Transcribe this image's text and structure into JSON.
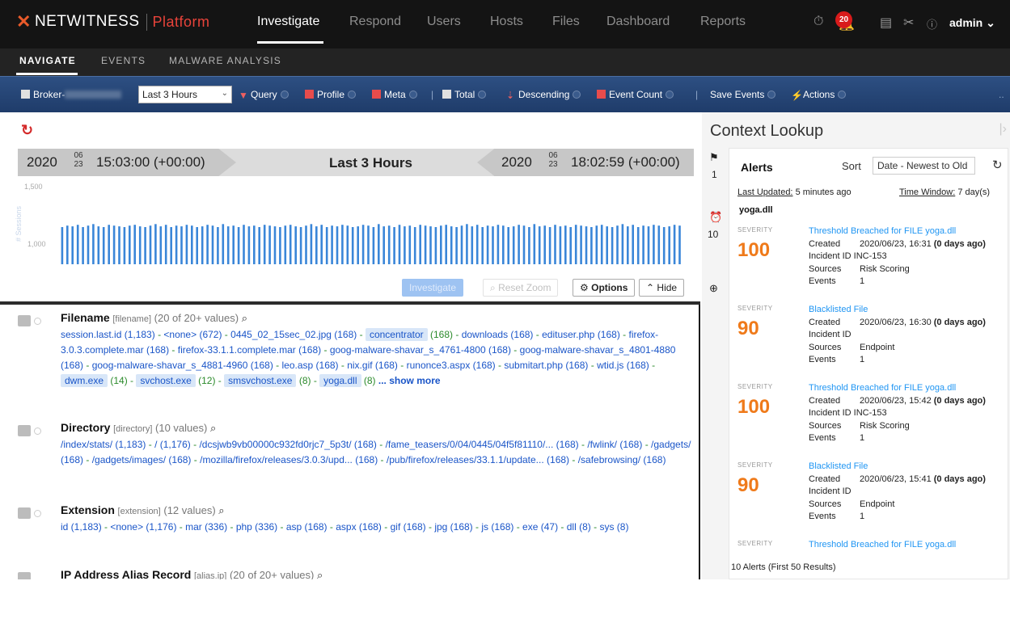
{
  "brand": {
    "name": "NETWITNESS",
    "product": "Platform"
  },
  "nav": {
    "items": [
      {
        "label": "Investigate",
        "active": true
      },
      {
        "label": "Respond",
        "active": false
      },
      {
        "label": "Users",
        "active": false
      },
      {
        "label": "Hosts",
        "active": false
      },
      {
        "label": "Files",
        "active": false
      },
      {
        "label": "Dashboard",
        "active": false
      },
      {
        "label": "Reports",
        "active": false
      }
    ],
    "notification_count": "20",
    "user": "admin"
  },
  "subnav": {
    "items": [
      "NAVIGATE",
      "EVENTS",
      "MALWARE ANALYSIS"
    ]
  },
  "toolbar": {
    "broker": "Broker-",
    "time_range": "Last 3 Hours",
    "query": "Query",
    "profile": "Profile",
    "meta": "Meta",
    "total": "Total",
    "descending": "Descending",
    "event_count": "Event Count",
    "save_events": "Save Events",
    "actions": "Actions"
  },
  "timeline": {
    "start_year": "2020",
    "start_month": "06",
    "start_day": "23",
    "start_time": "15:03:00 (+00:00)",
    "range_label": "Last 3 Hours",
    "end_year": "2020",
    "end_month": "06",
    "end_day": "23",
    "end_time": "18:02:59 (+00:00)",
    "y_ticks": [
      "1,500",
      "1,000"
    ],
    "y_axis_label": "# Sessions",
    "buttons": {
      "investigate": "Investigate",
      "reset_zoom": "Reset Zoom",
      "options": "Options",
      "hide": "Hide"
    }
  },
  "chart_data": {
    "type": "bar",
    "title": "",
    "ylabel": "# Sessions",
    "ylim": [
      0,
      1500
    ],
    "xlim": [
      "15:03:00",
      "18:02:59"
    ],
    "values": [
      1000,
      1020,
      1010,
      1030,
      1000,
      1020,
      1040,
      1010,
      1000,
      1030,
      1020,
      1010,
      1000,
      1020,
      1030,
      1010,
      1000,
      1020,
      1040,
      1010,
      1030,
      1000,
      1020,
      1010,
      1030,
      1020,
      1000,
      1010,
      1030,
      1020,
      1000,
      1040,
      1010,
      1020,
      1000,
      1030,
      1010,
      1020,
      1000,
      1030,
      1020,
      1010,
      1000,
      1020,
      1030,
      1010,
      1000,
      1020,
      1040,
      1010,
      1030,
      1000,
      1020,
      1010,
      1030,
      1020,
      1000,
      1010,
      1030,
      1020,
      1000,
      1040,
      1010,
      1020,
      1000,
      1030,
      1010,
      1020,
      1000,
      1030,
      1020,
      1010,
      1000,
      1020,
      1030,
      1010,
      1000,
      1020,
      1040,
      1010,
      1030,
      1000,
      1020,
      1010,
      1030,
      1020,
      1000,
      1010,
      1030,
      1020,
      1000,
      1040,
      1010,
      1020,
      1000,
      1030,
      1010,
      1020,
      1000,
      1030,
      1020,
      1010,
      1000,
      1020,
      1030,
      1010,
      1000,
      1020,
      1040,
      1010,
      1030,
      1000,
      1020,
      1010,
      1030,
      1020,
      1000,
      1010,
      1030,
      1020
    ]
  },
  "meta_keys": [
    {
      "name": "Filename",
      "key": "[filename]",
      "count": "(20 of 20+ values)",
      "values": [
        {
          "t": "session.last.id (1,183)"
        },
        {
          "t": "<none> (672)"
        },
        {
          "t": "0445_02_15sec_02.jpg (168)"
        },
        {
          "t": "concentrator",
          "hl": true,
          "n": "(168)"
        },
        {
          "t": "downloads (168)"
        },
        {
          "t": "edituser.php (168)"
        },
        {
          "t": "firefox-3.0.3.complete.mar (168)"
        },
        {
          "t": "firefox-33.1.1.complete.mar (168)"
        },
        {
          "t": "goog-malware-shavar_s_4761-4800 (168)"
        },
        {
          "t": "goog-malware-shavar_s_4801-4880 (168)"
        },
        {
          "t": "goog-malware-shavar_s_4881-4960 (168)"
        },
        {
          "t": "leo.asp (168)"
        },
        {
          "t": "nix.gif (168)"
        },
        {
          "t": "runonce3.aspx (168)"
        },
        {
          "t": "submitart.php (168)"
        },
        {
          "t": "wtid.js (168)"
        },
        {
          "t": "dwm.exe",
          "hl": true,
          "n": "(14)"
        },
        {
          "t": "svchost.exe",
          "hl": true,
          "n": "(12)"
        },
        {
          "t": "smsvchost.exe",
          "hl": true,
          "n": "(8)"
        },
        {
          "t": "yoga.dll",
          "hl": true,
          "n": "(8)"
        }
      ],
      "show_more": "... show more"
    },
    {
      "name": "Directory",
      "key": "[directory]",
      "count": "(10 values)",
      "values": [
        {
          "t": "/index/stats/ (1,183)"
        },
        {
          "t": "/ (1,176)"
        },
        {
          "t": "/dcsjwb9vb00000c932fd0rjc7_5p3t/ (168)"
        },
        {
          "t": "/fame_teasers/0/04/0445/04f5f81110/... (168)"
        },
        {
          "t": "/fwlink/ (168)"
        },
        {
          "t": "/gadgets/ (168)"
        },
        {
          "t": "/gadgets/images/ (168)"
        },
        {
          "t": "/mozilla/firefox/releases/3.0.3/upd... (168)"
        },
        {
          "t": "/pub/firefox/releases/33.1.1/update... (168)"
        },
        {
          "t": "/safebrowsing/ (168)"
        }
      ]
    },
    {
      "name": "Extension",
      "key": "[extension]",
      "count": "(12 values)",
      "values": [
        {
          "t": "id (1,183)"
        },
        {
          "t": "<none> (1,176)"
        },
        {
          "t": "mar (336)"
        },
        {
          "t": "php (336)"
        },
        {
          "t": "asp (168)"
        },
        {
          "t": "aspx (168)"
        },
        {
          "t": "gif (168)"
        },
        {
          "t": "jpg (168)"
        },
        {
          "t": "js (168)"
        },
        {
          "t": "exe (47)"
        },
        {
          "t": "dll (8)"
        },
        {
          "t": "sys (8)"
        }
      ]
    },
    {
      "name": "IP Address Alias Record",
      "key": "[alias.ip]",
      "count": "(20 of 20+ values)",
      "values": []
    }
  ],
  "context": {
    "title": "Context Lookup",
    "rail": {
      "flag_count": "1",
      "alert_count": "10"
    },
    "alerts_label": "Alerts",
    "sort_label": "Sort",
    "sort_value": "Date - Newest to Old",
    "last_updated_label": "Last Updated:",
    "last_updated_value": "5 minutes ago",
    "time_window_label": "Time Window:",
    "time_window_value": "7 day(s)",
    "file": "yoga.dll",
    "severity_label": "SEVERITY",
    "alerts": [
      {
        "severity": "100",
        "name": "Threshold Breached for FILE yoga.dll",
        "created": "2020/06/23, 16:31",
        "ago": "(0 days ago)",
        "incident": "INC-153",
        "sources": "Risk Scoring",
        "events": "1"
      },
      {
        "severity": "90",
        "name": "Blacklisted File",
        "created": "2020/06/23, 16:30",
        "ago": "(0 days ago)",
        "incident": "",
        "sources": "Endpoint",
        "events": "1"
      },
      {
        "severity": "100",
        "name": "Threshold Breached for FILE yoga.dll",
        "created": "2020/06/23, 15:42",
        "ago": "(0 days ago)",
        "incident": "INC-153",
        "sources": "Risk Scoring",
        "events": "1"
      },
      {
        "severity": "90",
        "name": "Blacklisted File",
        "created": "2020/06/23, 15:41",
        "ago": "(0 days ago)",
        "incident": "",
        "sources": "Endpoint",
        "events": "1"
      },
      {
        "severity": "",
        "name": "Threshold Breached for FILE yoga.dll"
      }
    ],
    "row_labels": {
      "created": "Created",
      "incident": "Incident ID",
      "sources": "Sources",
      "events": "Events"
    },
    "footer": "10 Alerts (First 50 Results)"
  }
}
